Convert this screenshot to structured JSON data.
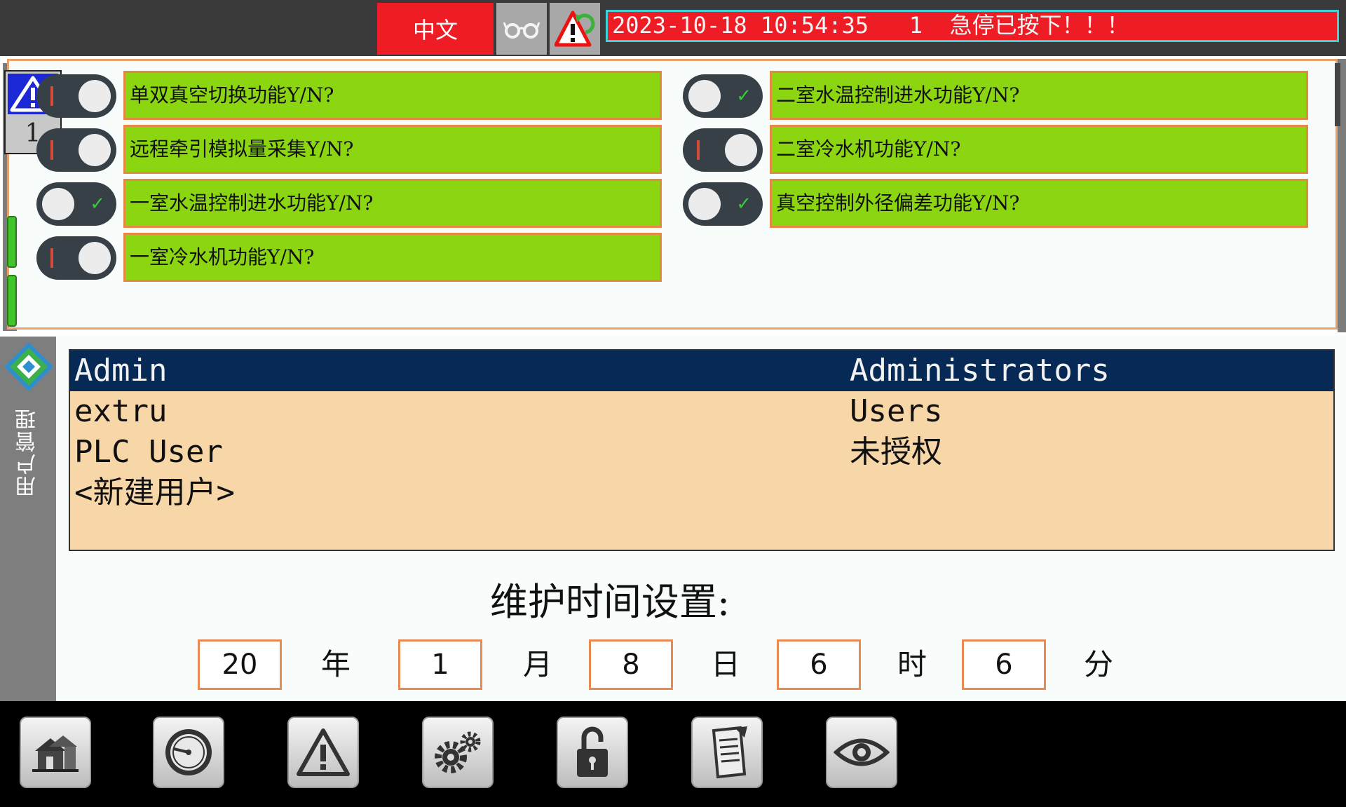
{
  "topbar": {
    "language_label": "中文",
    "alarm_message": "2023-10-18 10:54:35   1  急停已按下！！！"
  },
  "alarm_badge": {
    "count": "1"
  },
  "functions": {
    "left": [
      {
        "label": "单双真空切换功能Y/N?",
        "state": "off"
      },
      {
        "label": "远程牵引模拟量采集Y/N?",
        "state": "off"
      },
      {
        "label": "一室水温控制进水功能Y/N?",
        "state": "on"
      },
      {
        "label": "一室冷水机功能Y/N?",
        "state": "off"
      }
    ],
    "right": [
      {
        "label": "二室水温控制进水功能Y/N?",
        "state": "on"
      },
      {
        "label": "二室冷水机功能Y/N?",
        "state": "off"
      },
      {
        "label": "真空控制外径偏差功能Y/N?",
        "state": "on"
      }
    ]
  },
  "user_management": {
    "title": "用户管理",
    "users": [
      {
        "name": "Admin",
        "group": "Administrators",
        "selected": true
      },
      {
        "name": "extru",
        "group": "Users",
        "selected": false
      },
      {
        "name": "PLC User",
        "group": "未授权",
        "selected": false
      },
      {
        "name": "<新建用户>",
        "group": "",
        "selected": false
      }
    ]
  },
  "maintenance": {
    "title": "维护时间设置:",
    "fields": [
      {
        "value": "20",
        "unit": "年"
      },
      {
        "value": "1",
        "unit": "月"
      },
      {
        "value": "8",
        "unit": "日"
      },
      {
        "value": "6",
        "unit": "时"
      },
      {
        "value": "6",
        "unit": "分"
      }
    ]
  },
  "nav_icons": [
    "home-icon",
    "gauge-icon",
    "alarm-icon",
    "settings-icon",
    "unlock-icon",
    "recipe-icon",
    "view-icon"
  ],
  "colors": {
    "alarm_red": "#ee1c25",
    "func_green": "#8bd611",
    "table_bg": "#f7d6a8",
    "selected_row": "#062a55"
  }
}
